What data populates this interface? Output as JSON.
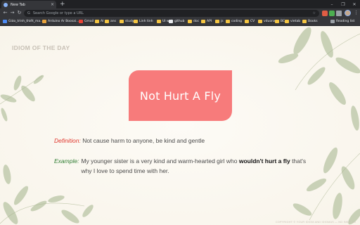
{
  "browser": {
    "tab_title": "New Tab",
    "tab_close": "×",
    "new_tab": "+",
    "window_controls": [
      "–",
      "❐",
      "✕"
    ],
    "omnibox_placeholder": "Search Google or type a URL",
    "bookmarks": [
      {
        "label": "Giáo_trình_thiết_ma...",
        "color": "#4c8bf5"
      },
      {
        "label": "Arduino Ar Boosai...",
        "color": "#e8a33c"
      },
      {
        "label": "Gmail",
        "color": "#ea4335"
      },
      {
        "label": "AI",
        "color": "#f4c542"
      },
      {
        "label": "ans",
        "color": "#f4c542"
      },
      {
        "label": "study",
        "color": "#f4c542"
      },
      {
        "label": "Linh tinh",
        "color": "#f4c542"
      },
      {
        "label": "UI web",
        "color": "#f4c542"
      },
      {
        "label": "github",
        "color": "#e8eaed"
      },
      {
        "label": "doc",
        "color": "#f4c542"
      },
      {
        "label": "API",
        "color": "#f4c542"
      },
      {
        "label": "js",
        "color": "#f4c542"
      },
      {
        "label": "coding",
        "color": "#f4c542"
      },
      {
        "label": "CV",
        "color": "#f4c542"
      },
      {
        "label": "vduonx",
        "color": "#f4c542"
      },
      {
        "label": "BC",
        "color": "#f4c542"
      },
      {
        "label": "vietab",
        "color": "#f4c542"
      },
      {
        "label": "Books",
        "color": "#f4c542"
      }
    ],
    "reading_list": "Reading list"
  },
  "page": {
    "section_label": "IDIOM OF THE DAY",
    "idiom": "Not Hurt A Fly",
    "definition_label": "Definition:",
    "definition_text": "Not cause harm to anyone, be kind and gentle",
    "example_label": "Example:",
    "example_before": "My younger sister is a very kind and warm-hearted girl who ",
    "example_bold": "wouldn't hurt a fly",
    "example_after": " that's why I love to spend time with her.",
    "copyright": "COPYRIGHT © YOUR IDIOM AND IDIOMAS — ND INKIT TO"
  },
  "colors": {
    "card": "#f77b7b",
    "definition_label": "#e0352b",
    "example_label": "#2e7d32",
    "leaf": "#b9c4a4"
  }
}
